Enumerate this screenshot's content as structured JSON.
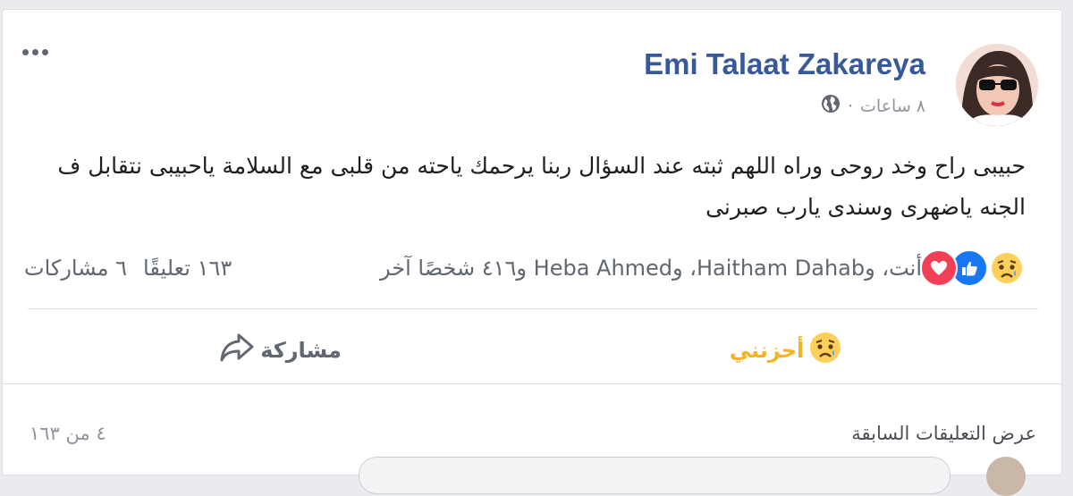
{
  "post": {
    "author_name": "Emi Talaat Zakareya",
    "timestamp": "٨ ساعات",
    "separator": "·",
    "privacy_icon": "globe-icon",
    "text": "حبيبى راح وخد روحى وراه اللهم ثبته عند السؤال ربنا يرحمك ياحته من قلبى مع السلامة ياحبيبى نتقابل ف الجنه ياضهرى وسندى يارب صبرنى"
  },
  "reactions": {
    "icons": [
      "sad-reaction-icon",
      "like-reaction-icon",
      "love-reaction-icon"
    ],
    "summary": "أنت، وHaitham Dahab، وHeba Ahmed و٤١٦ شخصًا آخر",
    "comments_count": "١٦٣ تعليقًا",
    "shares_count": "٦ مشاركات"
  },
  "actions": {
    "reacted_label": "أحزنني",
    "share_label": "مشاركة"
  },
  "comments": {
    "view_previous_label": "عرض التعليقات السابقة",
    "pager_text": "٤ من ١٦٣"
  },
  "colors": {
    "author": "#385898",
    "sad_active": "#f7b125",
    "like_blue": "#1877f2",
    "love_red": "#f33e58"
  }
}
